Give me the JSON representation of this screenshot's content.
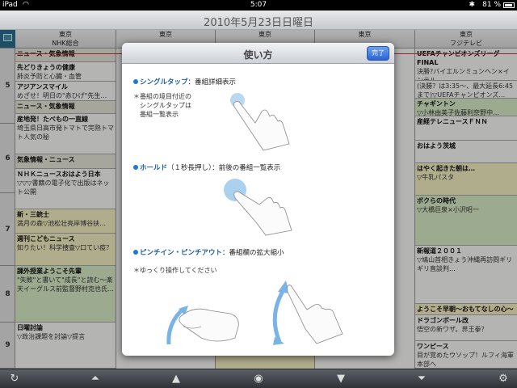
{
  "status": {
    "carrier": "iPad",
    "time": "5:07",
    "battery": "81 %"
  },
  "title": {
    "date": "2010年5月23日日曜日"
  },
  "channels": [
    {
      "area": "東京",
      "name": "NHK総合"
    },
    {
      "area": "東京",
      "name": ""
    },
    {
      "area": "東京",
      "name": ""
    },
    {
      "area": "東京",
      "name": ""
    },
    {
      "area": "東京",
      "name": "フジテレビ"
    }
  ],
  "hours": [
    "5",
    "6",
    "7",
    "8",
    "9"
  ],
  "col1": [
    {
      "title": "ニュース・気象情報",
      "desc": ""
    },
    {
      "title": "先どりきょうの健康",
      "desc": "肺炎予防と心臓・血管"
    },
    {
      "title": "アジアンスマイル",
      "desc": "めざせ！明日の\"赤ひげ\"先生…"
    },
    {
      "title": "ニュース・気象情報",
      "desc": ""
    },
    {
      "title": "産地発！たべもの一直線",
      "desc": "埼玉県日高市発トマトで完熟トマト人気の秘"
    },
    {
      "title": "気象情報・ニュース",
      "desc": ""
    },
    {
      "title": "ＮＨＫニュースおはよう日本",
      "desc": "▽▽▽書籍の電子化で出版はネット公開"
    },
    {
      "title": "新・三銃士",
      "desc": "満月の森▽池松壮亮岸博谷扶…"
    },
    {
      "title": "週刊こどもニュース",
      "desc": "知りたい！科学捜査▽口てい疫？"
    },
    {
      "title": "課外授業ようこそ先輩",
      "desc": "\"失敗\"と書いて\"成長\"と読む〜楽天イーグルス前監督野村克也氏…"
    },
    {
      "title": "日曜討論",
      "desc": "▽政治課題を討論▽提言"
    }
  ],
  "col5": [
    {
      "title": "UEFAチャンピオンズリーグFINAL",
      "desc": "決勝?バイエルンミュンヘン×インテル"
    },
    {
      "title": "",
      "desc": "(決勝？は3:35〜、最大延長6:45まで)▽UEFAチャンピオンズ…"
    },
    {
      "title": "チャギントン",
      "desc": "▽小林由美子佐藤利奈野中…"
    },
    {
      "title": "産経テレニュースＦＮＮ",
      "desc": ""
    },
    {
      "title": "おはよう茨城",
      "desc": ""
    },
    {
      "title": "はやく起きた朝は…",
      "desc": "▽牛乳パスタ"
    },
    {
      "title": "ボクらの時代",
      "desc": "▽大橋巨泉×小沢昭一"
    },
    {
      "title": "新報道２００１",
      "desc": "▽鳩山首相きょう沖縄再訪問ギリギリ直談判…"
    },
    {
      "title": "ようこそ早朝〜おもてなしの心〜",
      "desc": ""
    },
    {
      "title": "ドラゴンボール改",
      "desc": "悟空の新ワザ。界王拳？"
    },
    {
      "title": "ワンピース",
      "desc": "目が覚めたウソップ！ルフィ海軍本部へ"
    }
  ],
  "modal": {
    "title": "使い方",
    "done": "完了",
    "single_title": "シングルタップ",
    "single_desc": "：番組詳細表示",
    "single_note1": "＊番組の境目付近の",
    "single_note2": "シングルタップは",
    "single_note3": "番組一覧表示",
    "hold_title": "ホールド",
    "hold_desc": "（１秒長押し）：前後の番組一覧表示",
    "pinch_title": "ピンチイン・ピンチアウト",
    "pinch_desc": "：番組欄の拡大縮小",
    "pinch_note": "＊ゆっくり操作してください"
  },
  "toolbar": {
    "refresh_icon": "refresh-icon",
    "up_double_icon": "double-up-arrow-icon",
    "up_icon": "up-arrow-icon",
    "now_icon": "circle-now-icon",
    "down_icon": "down-arrow-icon",
    "down_double_icon": "double-down-arrow-icon",
    "settings_icon": "gear-icon"
  },
  "colors": {
    "accent": "#1f78d1",
    "done_button": "#2a62d8"
  }
}
